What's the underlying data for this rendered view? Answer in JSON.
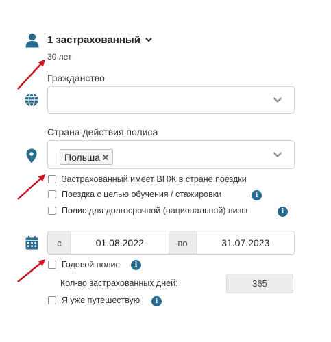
{
  "insured": {
    "title": "1 застрахованный",
    "age": "30 лет",
    "icon": "person-icon"
  },
  "citizenship": {
    "label": "Гражданство",
    "value": "",
    "icon": "globe-icon"
  },
  "policy_country": {
    "label": "Страна действия полиса",
    "selected_tag": "Польша",
    "icon": "location-pin-icon"
  },
  "options": [
    {
      "label": "Застрахованный имеет ВНЖ в стране поездки",
      "checked": false,
      "info": false
    },
    {
      "label": "Поездка с целью обучения / стажировки",
      "checked": false,
      "info": true
    },
    {
      "label": "Полис для долгосрочной (национальной) визы",
      "checked": false,
      "info": true
    }
  ],
  "dates": {
    "from_label": "с",
    "from_value": "01.08.2022",
    "to_label": "по",
    "to_value": "31.07.2023",
    "icon": "calendar-icon"
  },
  "annual_policy": {
    "label": "Годовой полис",
    "checked": false
  },
  "insured_days": {
    "label": "Кол-во застрахованных дней:",
    "value": "365"
  },
  "already_traveling": {
    "label": "Я уже путешествую",
    "checked": false
  },
  "colors": {
    "icon_blue": "#266a8f",
    "arrow_red": "#c8141e",
    "border": "#d4d4d4"
  }
}
